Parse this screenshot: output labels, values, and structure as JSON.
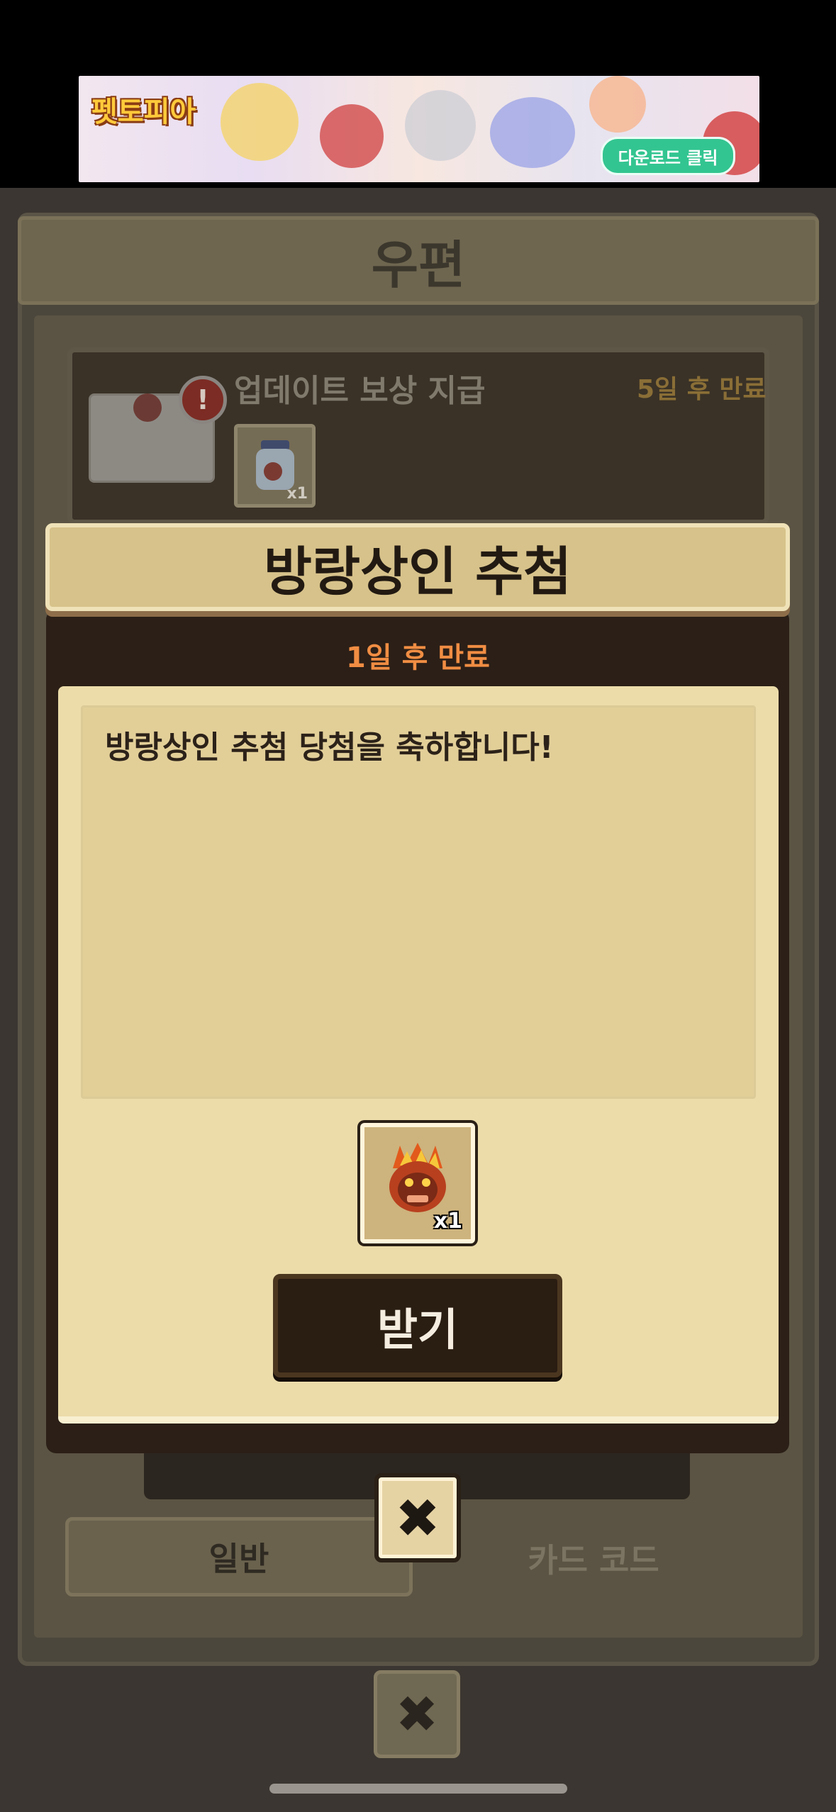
{
  "ad": {
    "logo_text": "펫토피아",
    "cta_label": "다운로드 클릭"
  },
  "mail": {
    "title": "우편",
    "item": {
      "title": "업데이트 보상 지급",
      "expiry": "5일 후 만료",
      "alert": "!",
      "quantity": "x1"
    },
    "tabs": [
      {
        "label": "일반"
      },
      {
        "label": "카드 코드"
      }
    ],
    "close_icon": "✖"
  },
  "popup": {
    "title": "방랑상인 추첨",
    "expiry": "1일 후 만료",
    "message": "방랑상인 추첨 당첨을 축하합니다!",
    "reward": {
      "icon": "fire-creature-icon",
      "quantity": "x1"
    },
    "receive_label": "받기",
    "close_icon": "✖"
  },
  "colors": {
    "accent_orange": "#f08d43",
    "parchment": "#ecdcaa",
    "dark_wood": "#2a1d12"
  }
}
